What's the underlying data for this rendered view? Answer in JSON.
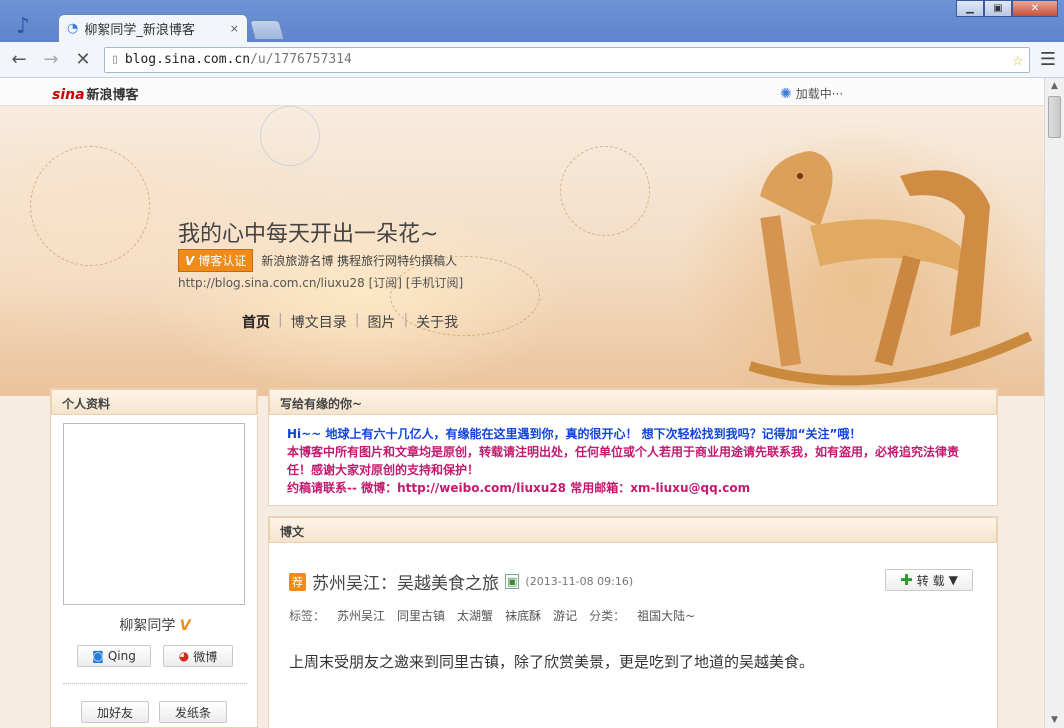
{
  "browser": {
    "tab_title": "柳絮同学_新浪博客",
    "tab_close": "×",
    "url_host": "blog.sina.com.cn",
    "url_path": "/u/1776757314"
  },
  "sina": {
    "logo": "sina",
    "logo_text": "新浪博客",
    "loading": "加载中···"
  },
  "blog": {
    "title": "我的心中每天开出一朵花~",
    "cert_label": "博客认证",
    "cert_desc": "新浪旅游名博 携程旅行网特约撰稿人",
    "url_line": "http://blog.sina.com.cn/liuxu28 [订阅] [手机订阅]",
    "nav": [
      "首页",
      "博文目录",
      "图片",
      "关于我"
    ]
  },
  "profile": {
    "header": "个人资料",
    "name": "柳絮同学",
    "qing": "Qing",
    "weibo": "微博",
    "add_friend": "加好友",
    "send_note": "发纸条"
  },
  "welcome": {
    "header": "写给有缘的你~",
    "line1": "Hi~~ 地球上有六十几亿人，有缘能在这里遇到你，真的很开心！  想下次轻松找到我吗？记得加“关注”哦！",
    "line2": "本博客中所有图片和文章均是原创，转载请注明出处，任何单位或个人若用于商业用途请先联系我，如有盗用，必将追究法律责任！感谢大家对原创的支持和保护！",
    "line3": "约稿请联系-- 微博：http://weibo.com/liuxu28        常用邮箱：xm-liuxu@qq.com"
  },
  "posts": {
    "header": "博文",
    "rec": "荐",
    "title": "苏州吴江：吴越美食之旅",
    "date": "(2013-11-08 09:16)",
    "repost": "转 载",
    "tags_label": "标签：",
    "tags": [
      "苏州吴江",
      "同里古镇",
      "太湖蟹",
      "袜底酥",
      "游记"
    ],
    "category_label": "分类：",
    "category": "祖国大陆~",
    "body": "上周末受朋友之邀来到同里古镇，除了欣赏美景，更是吃到了地道的吴越美食。"
  }
}
